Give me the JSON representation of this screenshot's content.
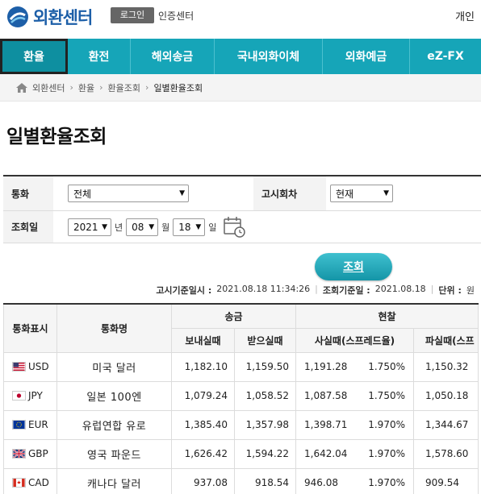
{
  "header": {
    "logo_text": "외환센터",
    "login_label": "로그인",
    "cert_label": "인증센터",
    "personal_label": "개인"
  },
  "nav": [
    "환율",
    "환전",
    "해외송금",
    "국내외화이체",
    "외화예금",
    "eZ-FX"
  ],
  "breadcrumb": [
    "외환센터",
    "환율",
    "환율조회",
    "일별환율조회"
  ],
  "page_title": "일별환율조회",
  "form": {
    "currency_label": "통화",
    "currency_value": "전체",
    "notice_label": "고시회차",
    "notice_value": "현재",
    "date_label": "조회일",
    "year": "2021",
    "year_unit": "년",
    "month": "08",
    "month_unit": "월",
    "day": "18",
    "day_unit": "일"
  },
  "search_label": "조회",
  "info": {
    "notice_time_label": "고시기준일시 :",
    "notice_time": "2021.08.18 11:34:26",
    "query_date_label": "조회기준일 :",
    "query_date": "2021.08.18",
    "unit_label": "단위 :",
    "unit": "원"
  },
  "table": {
    "h_code": "통화표시",
    "h_name": "통화명",
    "h_send": "송금",
    "h_cash": "현찰",
    "h_send_out": "보내실때",
    "h_send_in": "받으실때",
    "h_cash_buy": "사실때(스프레드율)",
    "h_cash_sell": "파실때(스프",
    "rows": [
      {
        "code": "USD",
        "name": "미국 달러",
        "send": "1,182.10",
        "receive": "1,159.50",
        "buy": "1,191.28",
        "spread": "1.750%",
        "sell": "1,150.32",
        "flag": "us"
      },
      {
        "code": "JPY",
        "name": "일본 100엔",
        "send": "1,079.24",
        "receive": "1,058.52",
        "buy": "1,087.58",
        "spread": "1.750%",
        "sell": "1,050.18",
        "flag": "jp"
      },
      {
        "code": "EUR",
        "name": "유럽연합 유로",
        "send": "1,385.40",
        "receive": "1,357.98",
        "buy": "1,398.71",
        "spread": "1.970%",
        "sell": "1,344.67",
        "flag": "eu"
      },
      {
        "code": "GBP",
        "name": "영국 파운드",
        "send": "1,626.42",
        "receive": "1,594.22",
        "buy": "1,642.04",
        "spread": "1.970%",
        "sell": "1,578.60",
        "flag": "gb"
      },
      {
        "code": "CAD",
        "name": "캐나다 달러",
        "send": "937.08",
        "receive": "918.54",
        "buy": "946.08",
        "spread": "1.970%",
        "sell": "909.54",
        "flag": "ca"
      }
    ]
  },
  "colors": {
    "nav": "#16a5b8",
    "brand": "#1d5fa8",
    "button": "#1495a7"
  }
}
